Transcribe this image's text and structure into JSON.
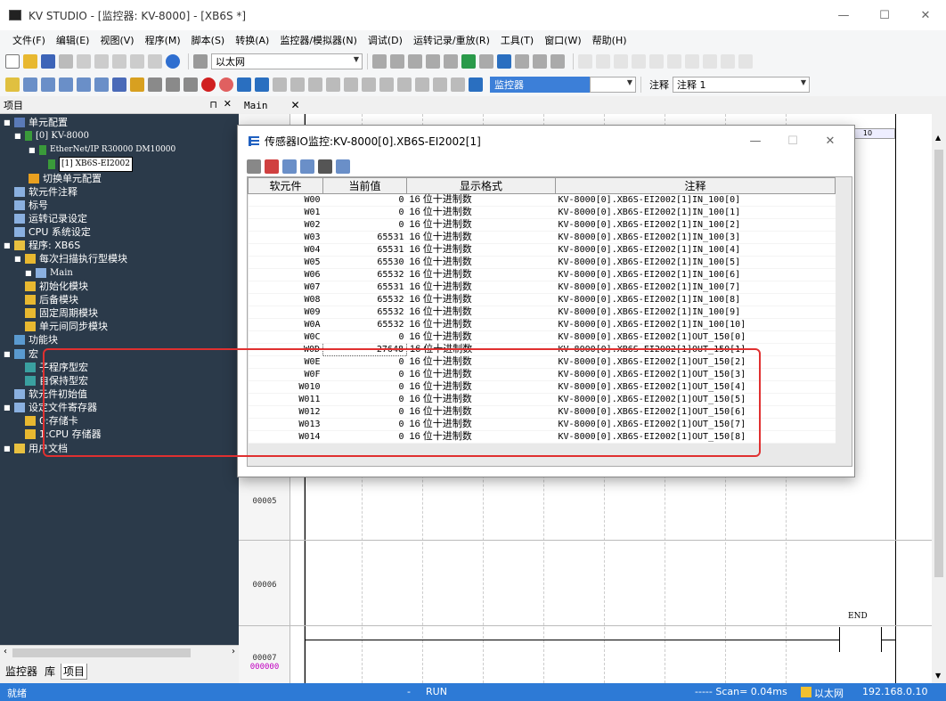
{
  "window": {
    "title": "KV STUDIO - [监控器: KV-8000] - [XB6S *]",
    "min": "—",
    "max": "☐",
    "close": "✕"
  },
  "menubar": [
    "文件(F)",
    "编辑(E)",
    "视图(V)",
    "程序(M)",
    "脚本(S)",
    "转换(A)",
    "监控器/模拟器(N)",
    "调试(D)",
    "运转记录/重放(R)",
    "工具(T)",
    "窗口(W)",
    "帮助(H)"
  ],
  "toolbar1": {
    "network": "以太网"
  },
  "toolbar2": {
    "mode": "监控器",
    "comment_label": "注释",
    "comment_select": "注释 1"
  },
  "project_panel": {
    "title": "项目",
    "pin": "⊓",
    "close": "✕"
  },
  "tree": [
    {
      "label": "单元配置"
    },
    {
      "label": "[0]  KV-8000"
    },
    {
      "label": "EtherNet/IP   R30000  DM10000"
    },
    {
      "label": "[1]  XB6S-EI2002"
    },
    {
      "label": "切换单元配置"
    },
    {
      "label": "软元件注释"
    },
    {
      "label": "标号"
    },
    {
      "label": "运转记录设定"
    },
    {
      "label": "CPU 系统设定"
    },
    {
      "label": "程序: XB6S"
    },
    {
      "label": "每次扫描执行型模块"
    },
    {
      "label": "Main"
    },
    {
      "label": "初始化模块"
    },
    {
      "label": "后备模块"
    },
    {
      "label": "固定周期模块"
    },
    {
      "label": "单元间同步模块"
    },
    {
      "label": "功能块"
    },
    {
      "label": "宏"
    },
    {
      "label": "子程序型宏"
    },
    {
      "label": "自保持型宏"
    },
    {
      "label": "软元件初始值"
    },
    {
      "label": "设定文件寄存器"
    },
    {
      "label": "0:存储卡"
    },
    {
      "label": "1:CPU 存储器"
    },
    {
      "label": "用户文档"
    }
  ],
  "bottom_tabs": [
    "监控器",
    "库",
    "项目"
  ],
  "editor": {
    "tab": "Main",
    "tab_close": "✕",
    "col_header": "10",
    "rows": [
      {
        "num": "00005",
        "sub": ""
      },
      {
        "num": "00006",
        "sub": ""
      },
      {
        "num": "00007",
        "sub": "000000"
      }
    ],
    "end_label": "END"
  },
  "dialog": {
    "title": "传感器IO监控:KV-8000[0].XB6S-EI2002[1]",
    "min": "—",
    "max": "☐",
    "close": "✕",
    "headers": [
      "软元件",
      "当前值",
      "显示格式",
      "注释"
    ],
    "rows": [
      {
        "dev": "W00",
        "val": "0",
        "fmt": "16 位十进制数",
        "cmt": "KV-8000[0].XB6S-EI2002[1]IN_100[0]"
      },
      {
        "dev": "W01",
        "val": "0",
        "fmt": "16 位十进制数",
        "cmt": "KV-8000[0].XB6S-EI2002[1]IN_100[1]"
      },
      {
        "dev": "W02",
        "val": "0",
        "fmt": "16 位十进制数",
        "cmt": "KV-8000[0].XB6S-EI2002[1]IN_100[2]"
      },
      {
        "dev": "W03",
        "val": "65531",
        "fmt": "16 位十进制数",
        "cmt": "KV-8000[0].XB6S-EI2002[1]IN_100[3]"
      },
      {
        "dev": "W04",
        "val": "65531",
        "fmt": "16 位十进制数",
        "cmt": "KV-8000[0].XB6S-EI2002[1]IN_100[4]"
      },
      {
        "dev": "W05",
        "val": "65530",
        "fmt": "16 位十进制数",
        "cmt": "KV-8000[0].XB6S-EI2002[1]IN_100[5]"
      },
      {
        "dev": "W06",
        "val": "65532",
        "fmt": "16 位十进制数",
        "cmt": "KV-8000[0].XB6S-EI2002[1]IN_100[6]"
      },
      {
        "dev": "W07",
        "val": "65531",
        "fmt": "16 位十进制数",
        "cmt": "KV-8000[0].XB6S-EI2002[1]IN_100[7]"
      },
      {
        "dev": "W08",
        "val": "65532",
        "fmt": "16 位十进制数",
        "cmt": "KV-8000[0].XB6S-EI2002[1]IN_100[8]"
      },
      {
        "dev": "W09",
        "val": "65532",
        "fmt": "16 位十进制数",
        "cmt": "KV-8000[0].XB6S-EI2002[1]IN_100[9]"
      },
      {
        "dev": "W0A",
        "val": "65532",
        "fmt": "16 位十进制数",
        "cmt": "KV-8000[0].XB6S-EI2002[1]IN_100[10]"
      },
      {
        "dev": "W0C",
        "val": "0",
        "fmt": "16 位十进制数",
        "cmt": "KV-8000[0].XB6S-EI2002[1]OUT_150[0]"
      },
      {
        "dev": "W0D",
        "val": "27648",
        "fmt": "16 位十进制数",
        "cmt": "KV-8000[0].XB6S-EI2002[1]OUT_150[1]"
      },
      {
        "dev": "W0E",
        "val": "0",
        "fmt": "16 位十进制数",
        "cmt": "KV-8000[0].XB6S-EI2002[1]OUT_150[2]"
      },
      {
        "dev": "W0F",
        "val": "0",
        "fmt": "16 位十进制数",
        "cmt": "KV-8000[0].XB6S-EI2002[1]OUT_150[3]"
      },
      {
        "dev": "W010",
        "val": "0",
        "fmt": "16 位十进制数",
        "cmt": "KV-8000[0].XB6S-EI2002[1]OUT_150[4]"
      },
      {
        "dev": "W011",
        "val": "0",
        "fmt": "16 位十进制数",
        "cmt": "KV-8000[0].XB6S-EI2002[1]OUT_150[5]"
      },
      {
        "dev": "W012",
        "val": "0",
        "fmt": "16 位十进制数",
        "cmt": "KV-8000[0].XB6S-EI2002[1]OUT_150[6]"
      },
      {
        "dev": "W013",
        "val": "0",
        "fmt": "16 位十进制数",
        "cmt": "KV-8000[0].XB6S-EI2002[1]OUT_150[7]"
      },
      {
        "dev": "W014",
        "val": "0",
        "fmt": "16 位十进制数",
        "cmt": "KV-8000[0].XB6S-EI2002[1]OUT_150[8]"
      }
    ]
  },
  "statusbar": {
    "ready": "就绪",
    "dash": "-",
    "run": "RUN",
    "scan": "----- Scan=  0.04ms",
    "net": "以太网",
    "ip": "192.168.0.10"
  },
  "colors": {
    "tree_bg": "#2b3a4a",
    "status_bg": "#2d7ad6",
    "highlight": "#e03030"
  }
}
